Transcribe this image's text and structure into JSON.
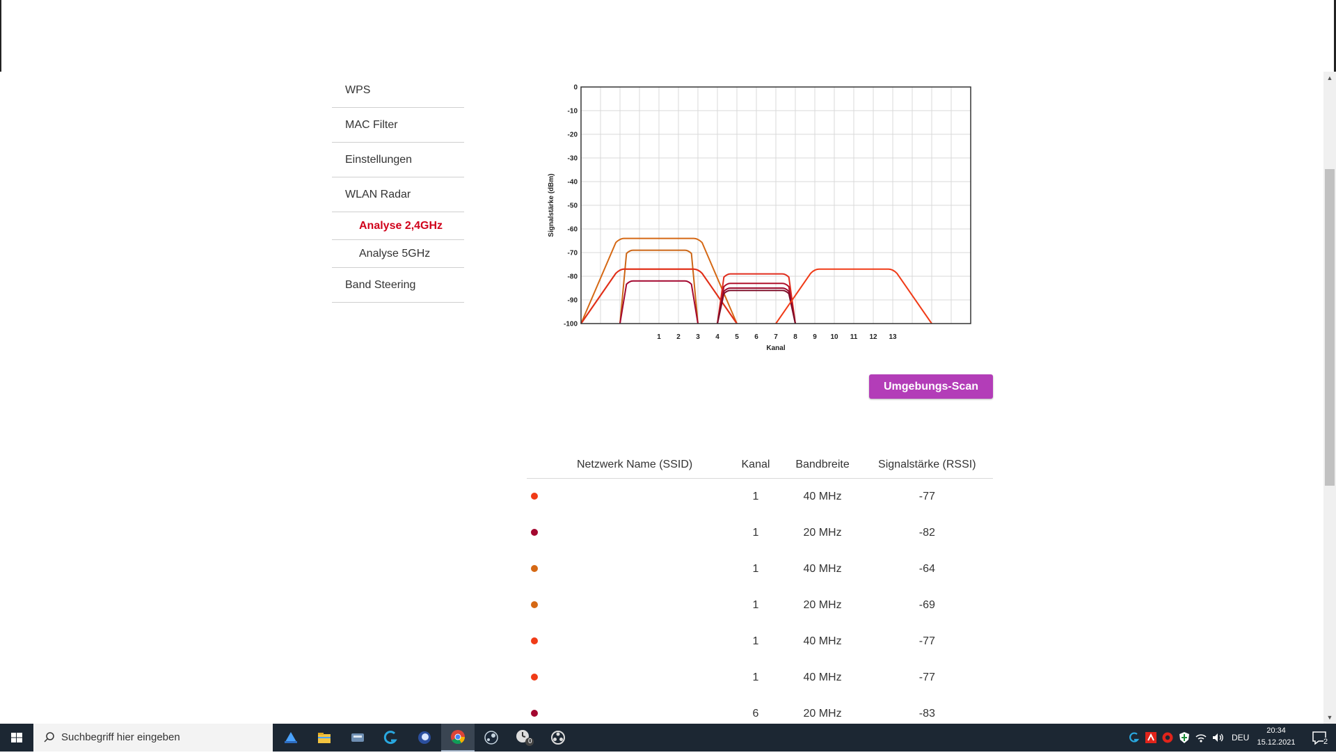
{
  "sidebar": {
    "items": [
      {
        "label": "WPS"
      },
      {
        "label": "MAC Filter"
      },
      {
        "label": "Einstellungen"
      },
      {
        "label": "WLAN Radar"
      }
    ],
    "sub_items": [
      {
        "label": "Analyse 2,4GHz",
        "active": true
      },
      {
        "label": "Analyse 5GHz",
        "active": false
      }
    ],
    "after_items": [
      {
        "label": "Band Steering"
      }
    ]
  },
  "colors": {
    "active_nav": "#d0021b",
    "scan_button": "#b33db8",
    "curve_colors": [
      "#f03b17",
      "#a3072f",
      "#d56814",
      "#c23a10",
      "#e02c1c",
      "#8b0e2a"
    ]
  },
  "chart_data": {
    "type": "line",
    "ylabel": "Signalstärke (dBm)",
    "xlabel": "Kanal",
    "yticks": [
      "0",
      "-10",
      "-20",
      "-30",
      "-40",
      "-50",
      "-60",
      "-70",
      "-80",
      "-90",
      "-100"
    ],
    "ylim": [
      -100,
      0
    ],
    "xticks": [
      "1",
      "2",
      "3",
      "4",
      "5",
      "6",
      "7",
      "8",
      "9",
      "10",
      "11",
      "12",
      "13"
    ],
    "xlim": [
      -3,
      17
    ],
    "grid": true,
    "series": [
      {
        "channel_low": -3,
        "plateau_start": -1,
        "plateau_end": 3,
        "channel_high": 5,
        "peak": -64,
        "color": "#d56814"
      },
      {
        "channel_low": -1,
        "plateau_start": -0.5,
        "plateau_end": 2.5,
        "channel_high": 3,
        "peak": -69,
        "color": "#cc6616"
      },
      {
        "channel_low": -3,
        "plateau_start": -1,
        "plateau_end": 3,
        "channel_high": 5,
        "peak": -77,
        "color": "#f03b17"
      },
      {
        "channel_low": -3,
        "plateau_start": -1,
        "plateau_end": 3,
        "channel_high": 5,
        "peak": -77,
        "color": "#e0301a"
      },
      {
        "channel_low": -1,
        "plateau_start": -0.5,
        "plateau_end": 2.5,
        "channel_high": 3,
        "peak": -82,
        "color": "#a3072f"
      },
      {
        "channel_low": 4,
        "plateau_start": 4.5,
        "plateau_end": 7.5,
        "channel_high": 8,
        "peak": -79,
        "color": "#e02c1c"
      },
      {
        "channel_low": 4,
        "plateau_start": 4.5,
        "plateau_end": 7.5,
        "channel_high": 8,
        "peak": -83,
        "color": "#b0102b"
      },
      {
        "channel_low": 4,
        "plateau_start": 4.5,
        "plateau_end": 7.5,
        "channel_high": 8,
        "peak": -85,
        "color": "#9a0a2c"
      },
      {
        "channel_low": 4,
        "plateau_start": 4.5,
        "plateau_end": 7.5,
        "channel_high": 8,
        "peak": -86,
        "color": "#7d0c28"
      },
      {
        "channel_low": 7,
        "plateau_start": 9,
        "plateau_end": 13,
        "channel_high": 15,
        "peak": -77,
        "color": "#f03b17"
      }
    ]
  },
  "scan_button": {
    "label": "Umgebungs-Scan"
  },
  "table": {
    "headers": [
      "",
      "Netzwerk Name (SSID)",
      "Kanal",
      "Bandbreite",
      "Signalstärke (RSSI)"
    ],
    "rows": [
      {
        "dot": "#f03b17",
        "ssid": "",
        "channel": "1",
        "bandwidth": "40 MHz",
        "rssi": "-77"
      },
      {
        "dot": "#a3072f",
        "ssid": "",
        "channel": "1",
        "bandwidth": "20 MHz",
        "rssi": "-82"
      },
      {
        "dot": "#d56814",
        "ssid": "",
        "channel": "1",
        "bandwidth": "40 MHz",
        "rssi": "-64"
      },
      {
        "dot": "#d56814",
        "ssid": "",
        "channel": "1",
        "bandwidth": "20 MHz",
        "rssi": "-69"
      },
      {
        "dot": "#f03b17",
        "ssid": "",
        "channel": "1",
        "bandwidth": "40 MHz",
        "rssi": "-77"
      },
      {
        "dot": "#f03b17",
        "ssid": "",
        "channel": "1",
        "bandwidth": "40 MHz",
        "rssi": "-77"
      },
      {
        "dot": "#a3072f",
        "ssid": "",
        "channel": "6",
        "bandwidth": "20 MHz",
        "rssi": "-83"
      }
    ]
  },
  "taskbar": {
    "search_placeholder": "Suchbegriff hier eingeben",
    "apps": [
      "blue-app-icon",
      "file-explorer-icon",
      "network-tool-icon",
      "logitech-icon",
      "cortana-ring-icon",
      "chrome-icon",
      "steam-icon",
      "clock-app-icon",
      "obs-icon"
    ],
    "app_badge": "0",
    "language": "DEU",
    "time": "20:34",
    "date": "15.12.2021",
    "notification_count": "2"
  }
}
